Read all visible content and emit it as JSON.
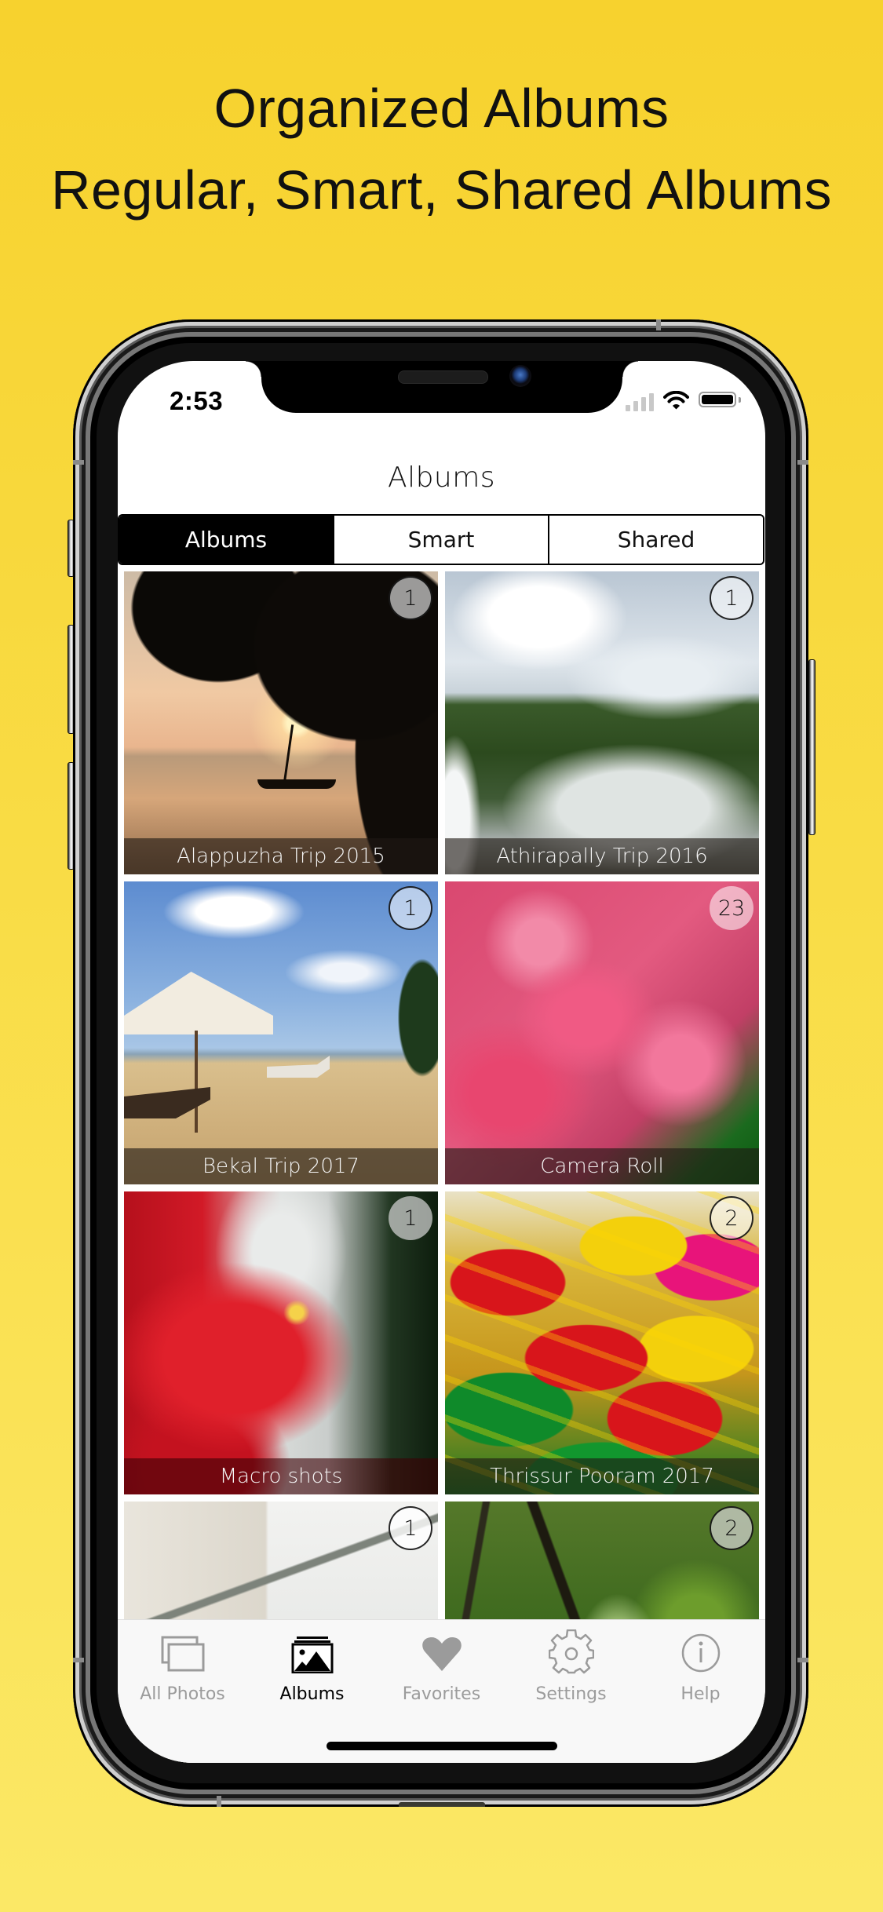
{
  "headline": {
    "line1": "Organized Albums",
    "line2": "Regular, Smart, Shared Albums"
  },
  "status_bar": {
    "time": "2:53",
    "signal_icon": "cellular-signal-icon",
    "wifi_icon": "wifi-icon",
    "battery_icon": "battery-icon"
  },
  "nav": {
    "title": "Albums"
  },
  "segments": [
    {
      "label": "Albums",
      "selected": true
    },
    {
      "label": "Smart",
      "selected": false
    },
    {
      "label": "Shared",
      "selected": false
    }
  ],
  "albums": [
    {
      "name": "Alappuzha Trip 2015",
      "count": "1"
    },
    {
      "name": "Athirapally Trip 2016",
      "count": "1"
    },
    {
      "name": "Bekal Trip 2017",
      "count": "1"
    },
    {
      "name": "Camera Roll",
      "count": "23"
    },
    {
      "name": "Macro shots",
      "count": "1"
    },
    {
      "name": "Thrissur Pooram 2017",
      "count": "2"
    },
    {
      "name": "",
      "count": "1"
    },
    {
      "name": "",
      "count": "2"
    }
  ],
  "tabbar": {
    "items": [
      {
        "label": "All Photos",
        "icon": "all-photos-icon",
        "selected": false
      },
      {
        "label": "Albums",
        "icon": "albums-icon",
        "selected": true
      },
      {
        "label": "Favorites",
        "icon": "heart-icon",
        "selected": false
      },
      {
        "label": "Settings",
        "icon": "gear-icon",
        "selected": false
      },
      {
        "label": "Help",
        "icon": "info-icon",
        "selected": false
      }
    ]
  },
  "colors": {
    "background_top": "#f7d22e",
    "background_bottom": "#fbe866",
    "tab_active": "#000000",
    "tab_inactive": "#9b9b9b",
    "segment_selected_bg": "#000000"
  }
}
